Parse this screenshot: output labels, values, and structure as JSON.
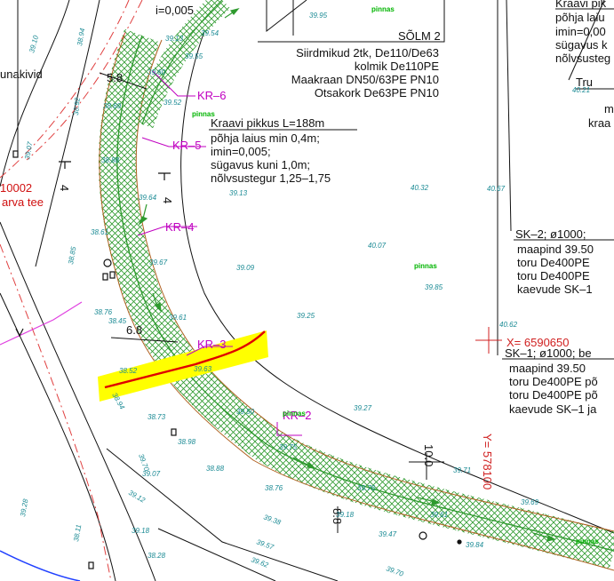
{
  "colors": {
    "ditch_hatch": "#2e9a2e",
    "slope_tick": "#b06020",
    "label_magenta": "#c000c0",
    "highlight": "#ffff00",
    "route_red": "#e00000",
    "elevation_cyan": "#1a8a94",
    "vegetation_green": "#00b400"
  },
  "slope_top_label": "i=0,005",
  "node_block": {
    "title": "SÕLM 2",
    "lines": [
      "Siirdmikud 2tk, De110/De63",
      "kolmik De110PE",
      "Maakraan DN50/63PE PN10",
      "Otsakork De63PE PN10"
    ]
  },
  "ditch_block": {
    "lines": [
      "Kraavi pikkus L=188m",
      "põhja laius min 0,4m;",
      "imin=0,005;",
      "sügavus kuni 1,0m;",
      "nõlvsustegur 1,25–1,75"
    ]
  },
  "right_top_block": {
    "lines": [
      "Kraavi pik",
      "põhja laiu",
      "imin=0,00",
      "sügavus k",
      "nõlvsusteg"
    ]
  },
  "tru_block": {
    "lines": [
      "Tru",
      "m",
      "kraa"
    ]
  },
  "sk2_block": {
    "lines": [
      "SK–2; ø1000;",
      "maapind 39.50",
      "toru De400PE",
      "toru De400PE",
      "kaevude SK–1"
    ]
  },
  "sk1_block": {
    "lines": [
      "SK–1; ø1000; be",
      "maapind 39.50",
      "toru De400PE põ",
      "toru De400PE põ",
      "kaevude SK–1 ja"
    ]
  },
  "coordinates": {
    "x_label": "X= 6590650",
    "y_label": "Y= 578100"
  },
  "left_labels": {
    "number": "10002",
    "road": "arva tee",
    "unakivid": "unakivid"
  },
  "kr_labels": [
    "KR–6",
    "KR–5",
    "KR–4",
    "KR–3",
    "KR–2"
  ],
  "dimensions": {
    "d58": "5.8",
    "d68": "6.8",
    "d10": "10.0",
    "d88": "8.8"
  },
  "side_numbers": {
    "four_a": "4",
    "four_b": "4"
  },
  "vegetation": "pinnas",
  "elevations": [
    "39.95",
    "39.13",
    "39.54",
    "39.55",
    "39.10",
    "38.94",
    "38.92",
    "39.07",
    "38.69",
    "39.60",
    "39.52",
    "38.88",
    "39.64",
    "39.13",
    "40.32",
    "40.67",
    "40.21",
    "38.61",
    "39.67",
    "40.07",
    "39.09",
    "38.85",
    "38.76",
    "38.45",
    "39.61",
    "39.85",
    "40.62",
    "38.52",
    "38.94",
    "39.63",
    "39.25",
    "39.27",
    "38.73",
    "38.98",
    "39.50",
    "39.75",
    "39.70",
    "39.07",
    "38.88",
    "39.71",
    "39.76",
    "39.69",
    "39.12",
    "38.76",
    "39.18",
    "39.61",
    "38.28",
    "39.38",
    "39.84",
    "39.47",
    "39.57",
    "39.62",
    "39.70",
    "38.11",
    "39.28",
    "39.18"
  ]
}
